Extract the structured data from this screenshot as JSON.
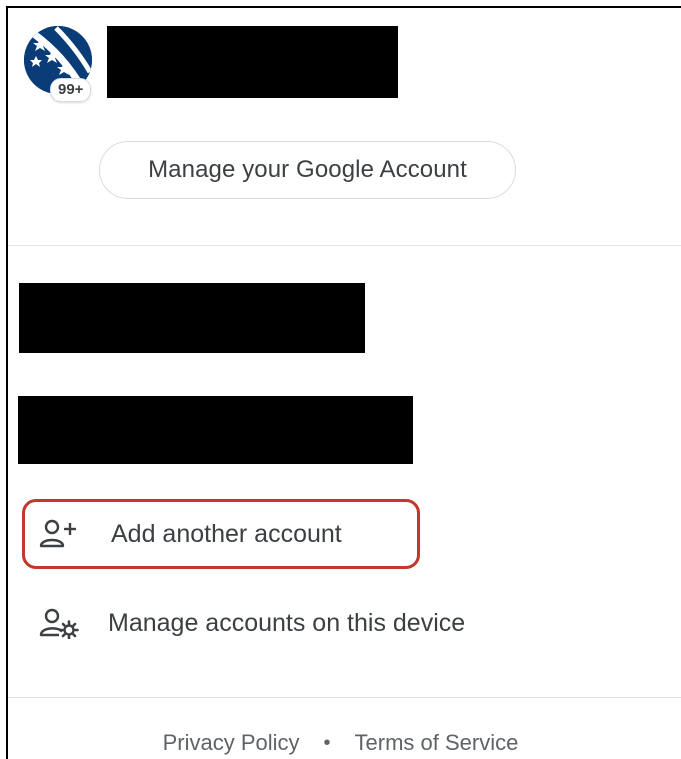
{
  "header": {
    "badge_count": "99+",
    "manage_account_label": "Manage your Google Account"
  },
  "menu": {
    "add_account_label": "Add another account",
    "manage_device_label": "Manage accounts on this device"
  },
  "footer": {
    "privacy_label": "Privacy Policy",
    "separator": "•",
    "terms_label": "Terms of Service"
  },
  "icons": {
    "avatar": "stars-avatar-icon",
    "add_account": "person-add-icon",
    "manage_device": "manage-accounts-icon"
  },
  "colors": {
    "avatar_bg": "#0a3d78",
    "highlight_border": "#c0392b",
    "text": "#3c4043",
    "muted_text": "#5f6368"
  }
}
